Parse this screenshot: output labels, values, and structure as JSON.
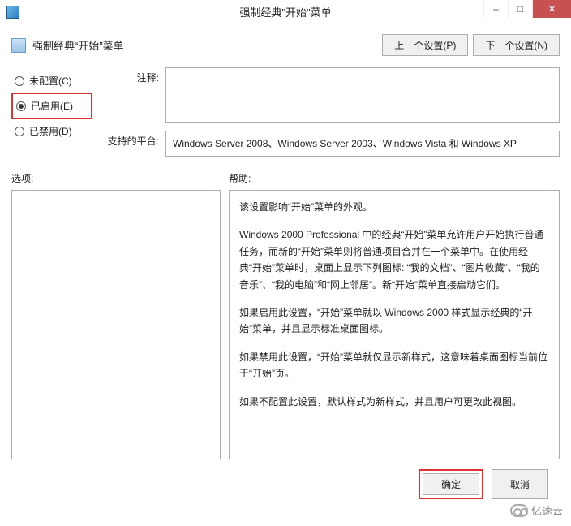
{
  "window": {
    "title": "强制经典\"开始\"菜单",
    "minimize": "–",
    "maximize": "□",
    "close": "✕"
  },
  "header": {
    "title": "强制经典“开始”菜单",
    "prev_button": "上一个设置(P)",
    "next_button": "下一个设置(N)"
  },
  "radios": {
    "not_configured": "未配置(C)",
    "enabled": "已启用(E)",
    "disabled": "已禁用(D)",
    "selected": "enabled"
  },
  "fields": {
    "comment_label": "注释:",
    "comment_value": "",
    "platform_label": "支持的平台:",
    "platform_value": "Windows Server 2008、Windows Server 2003、Windows Vista 和 Windows XP"
  },
  "lower": {
    "options_label": "选项:",
    "help_label": "帮助:",
    "help_paragraphs": [
      "该设置影响“开始”菜单的外观。",
      "Windows 2000 Professional 中的经典“开始”菜单允许用户开始执行普通任务，而新的“开始”菜单则将普通项目合并在一个菜单中。在使用经典“开始”菜单时，桌面上显示下列图标: “我的文档”、“图片收藏”、“我的音乐”、“我的电脑”和“网上邻居”。新“开始”菜单直接启动它们。",
      "如果启用此设置，“开始”菜单就以 Windows 2000 样式显示经典的“开始”菜单，并且显示标准桌面图标。",
      "如果禁用此设置，“开始”菜单就仅显示新样式，这意味着桌面图标当前位于“开始”页。",
      "如果不配置此设置，默认样式为新样式，并且用户可更改此视图。"
    ]
  },
  "footer": {
    "ok": "确定",
    "cancel": "取消"
  },
  "watermark": {
    "text": "亿速云"
  }
}
